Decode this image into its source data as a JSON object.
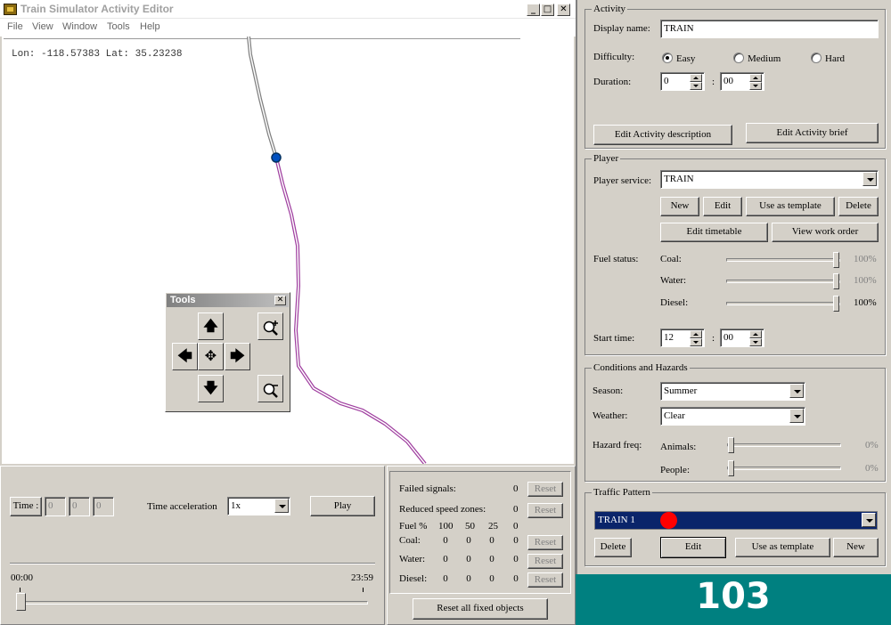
{
  "window": {
    "title": "Train Simulator Activity Editor",
    "minimize_glyph": "_",
    "maximize_glyph": "□",
    "close_glyph": "✕"
  },
  "menu": [
    "File",
    "View",
    "Window",
    "Tools",
    "Help"
  ],
  "map": {
    "coordinates": "Lon: -118.57383 Lat: 35.23238"
  },
  "tools_palette": {
    "title": "Tools",
    "close_glyph": "✕",
    "icons": [
      "arrow-up-icon",
      "arrow-down-icon",
      "arrow-left-icon",
      "arrow-right-icon",
      "move-center-icon",
      "zoom-in-icon",
      "zoom-out-icon"
    ],
    "glyphs": {
      "up": "🡅",
      "down": "🡇",
      "left": "🡄",
      "right": "🡆",
      "center": "✥"
    }
  },
  "time_panel": {
    "time_button": "Time :",
    "time_fields": [
      "0",
      "0",
      "0"
    ],
    "time_acceleration_label": "Time acceleration",
    "time_acceleration_value": "1x",
    "play_button": "Play",
    "slider_start": "00:00",
    "slider_end": "23:59"
  },
  "stats_panel": {
    "failed_signals_label": "Failed signals:",
    "failed_signals_value": "0",
    "reduced_speed_label": "Reduced speed zones:",
    "reduced_speed_value": "0",
    "fuel_header": {
      "label": "Fuel %",
      "cols": [
        "100",
        "50",
        "25",
        "0"
      ]
    },
    "rows": [
      {
        "label": "Coal:",
        "values": [
          "0",
          "0",
          "0",
          "0"
        ]
      },
      {
        "label": "Water:",
        "values": [
          "0",
          "0",
          "0",
          "0"
        ]
      },
      {
        "label": "Diesel:",
        "values": [
          "0",
          "0",
          "0",
          "0"
        ]
      }
    ],
    "reset_label": "Reset",
    "reset_all_button": "Reset all fixed objects"
  },
  "activity": {
    "group_title": "Activity",
    "display_name_label": "Display name:",
    "display_name_value": "TRAIN",
    "difficulty_label": "Difficulty:",
    "difficulty_options": [
      "Easy",
      "Medium",
      "Hard"
    ],
    "difficulty_selected": "Easy",
    "duration_label": "Duration:",
    "duration_hours": "0",
    "duration_minutes": "00",
    "colon": ":",
    "edit_description_button": "Edit Activity description",
    "edit_brief_button": "Edit Activity brief"
  },
  "player": {
    "group_title": "Player",
    "service_label": "Player service:",
    "service_value": "TRAIN",
    "new_button": "New",
    "edit_button": "Edit",
    "template_button": "Use as template",
    "delete_button": "Delete",
    "edit_timetable_button": "Edit timetable",
    "view_work_order_button": "View work order",
    "fuel_status_label": "Fuel status:",
    "fuel": [
      {
        "label": "Coal:",
        "value": "100%",
        "level": 1.0,
        "enabled": false
      },
      {
        "label": "Water:",
        "value": "100%",
        "level": 1.0,
        "enabled": false
      },
      {
        "label": "Diesel:",
        "value": "100%",
        "level": 1.0,
        "enabled": true
      }
    ],
    "start_time_label": "Start time:",
    "start_hours": "12",
    "start_minutes": "00"
  },
  "conditions": {
    "group_title": "Conditions and Hazards",
    "season_label": "Season:",
    "season_value": "Summer",
    "weather_label": "Weather:",
    "weather_value": "Clear",
    "hazard_label": "Hazard freq:",
    "hazards": [
      {
        "label": "Animals:",
        "value": "0%",
        "level": 0.0
      },
      {
        "label": "People:",
        "value": "0%",
        "level": 0.0
      }
    ]
  },
  "traffic": {
    "group_title": "Traffic Pattern",
    "selected": "TRAIN 1",
    "delete_button": "Delete",
    "edit_button": "Edit",
    "template_button": "Use as template",
    "new_button": "New"
  },
  "counter": {
    "value": "103"
  }
}
